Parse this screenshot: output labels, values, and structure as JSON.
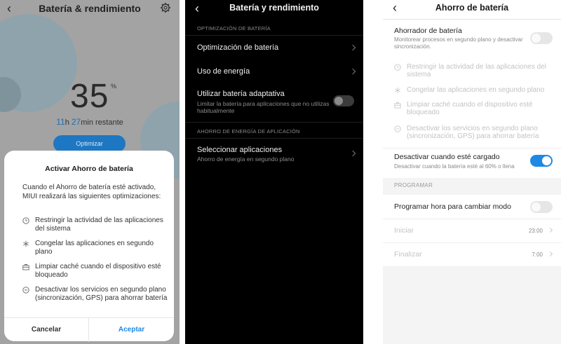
{
  "panel1": {
    "title": "Batería & rendimiento",
    "back_icon": "arrow-left-icon",
    "settings_icon": "gear-icon",
    "battery_percent": "35",
    "percent_sign": "%",
    "remaining": {
      "hours": "11",
      "h": "h",
      "minutes": "27",
      "suffix": "min restante"
    },
    "optimize_button": "Optimizar",
    "dialog": {
      "title": "Activar Ahorro de batería",
      "intro": "Cuando el Ahorro de batería esté activado, MIUI realizará las siguientes optimizaciones:",
      "items": [
        {
          "icon": "clock-icon",
          "text": "Restringir la actividad de las aplicaciones del sistema"
        },
        {
          "icon": "snowflake-icon",
          "text": "Congelar las aplicaciones en segundo plano"
        },
        {
          "icon": "briefcase-icon",
          "text": "Limpiar caché cuando el dispositivo esté bloqueado"
        },
        {
          "icon": "minus-circle-icon",
          "text": "Desactivar los servicios en segundo plano (sincronización, GPS) para ahorrar batería"
        }
      ],
      "cancel": "Cancelar",
      "accept": "Aceptar"
    }
  },
  "panel2": {
    "title": "Batería y rendimiento",
    "section1": "OPTIMIZACIÓN DE BATERÍA",
    "optimization": "Optimización de batería",
    "energy_use": "Uso de energía",
    "adaptive": "Utilizar batería adaptativa",
    "adaptive_sub": "Limitar la batería para aplicaciones que no utilizas habitualmente",
    "adaptive_on": false,
    "section2": "AHORRO DE ENERGÍA DE APLICACIÓN",
    "select_apps": "Seleccionar aplicaciones",
    "select_apps_sub": "Ahorro de energía en segundo plano"
  },
  "panel3": {
    "title": "Ahorro de batería",
    "saver": "Ahorrador de batería",
    "saver_sub": "Monitorear procesos en segundo plano y desactivar sincronización.",
    "saver_on": false,
    "items": [
      {
        "icon": "clock-icon",
        "text": "Restringir la actividad de las aplicaciones del sistema"
      },
      {
        "icon": "snowflake-icon",
        "text": "Congelar las aplicaciones en segundo plano"
      },
      {
        "icon": "briefcase-icon",
        "text": "Limpiar caché cuando el dispositivo esté bloqueado"
      },
      {
        "icon": "minus-circle-icon",
        "text": "Desactivar los servicios en segundo plano (sincronización, GPS) para ahorrar batería"
      }
    ],
    "charged": "Desactivar cuando esté cargado",
    "charged_sub": "Desactivar cuando la batería esté al 60% o llena",
    "charged_on": true,
    "schedule_section": "PROGRAMAR",
    "schedule": "Programar hora para cambiar modo",
    "schedule_on": false,
    "start_label": "Iniciar",
    "start_value": "23:00",
    "end_label": "Finalizar",
    "end_value": "7:00",
    "accent": "#1e88e5"
  }
}
